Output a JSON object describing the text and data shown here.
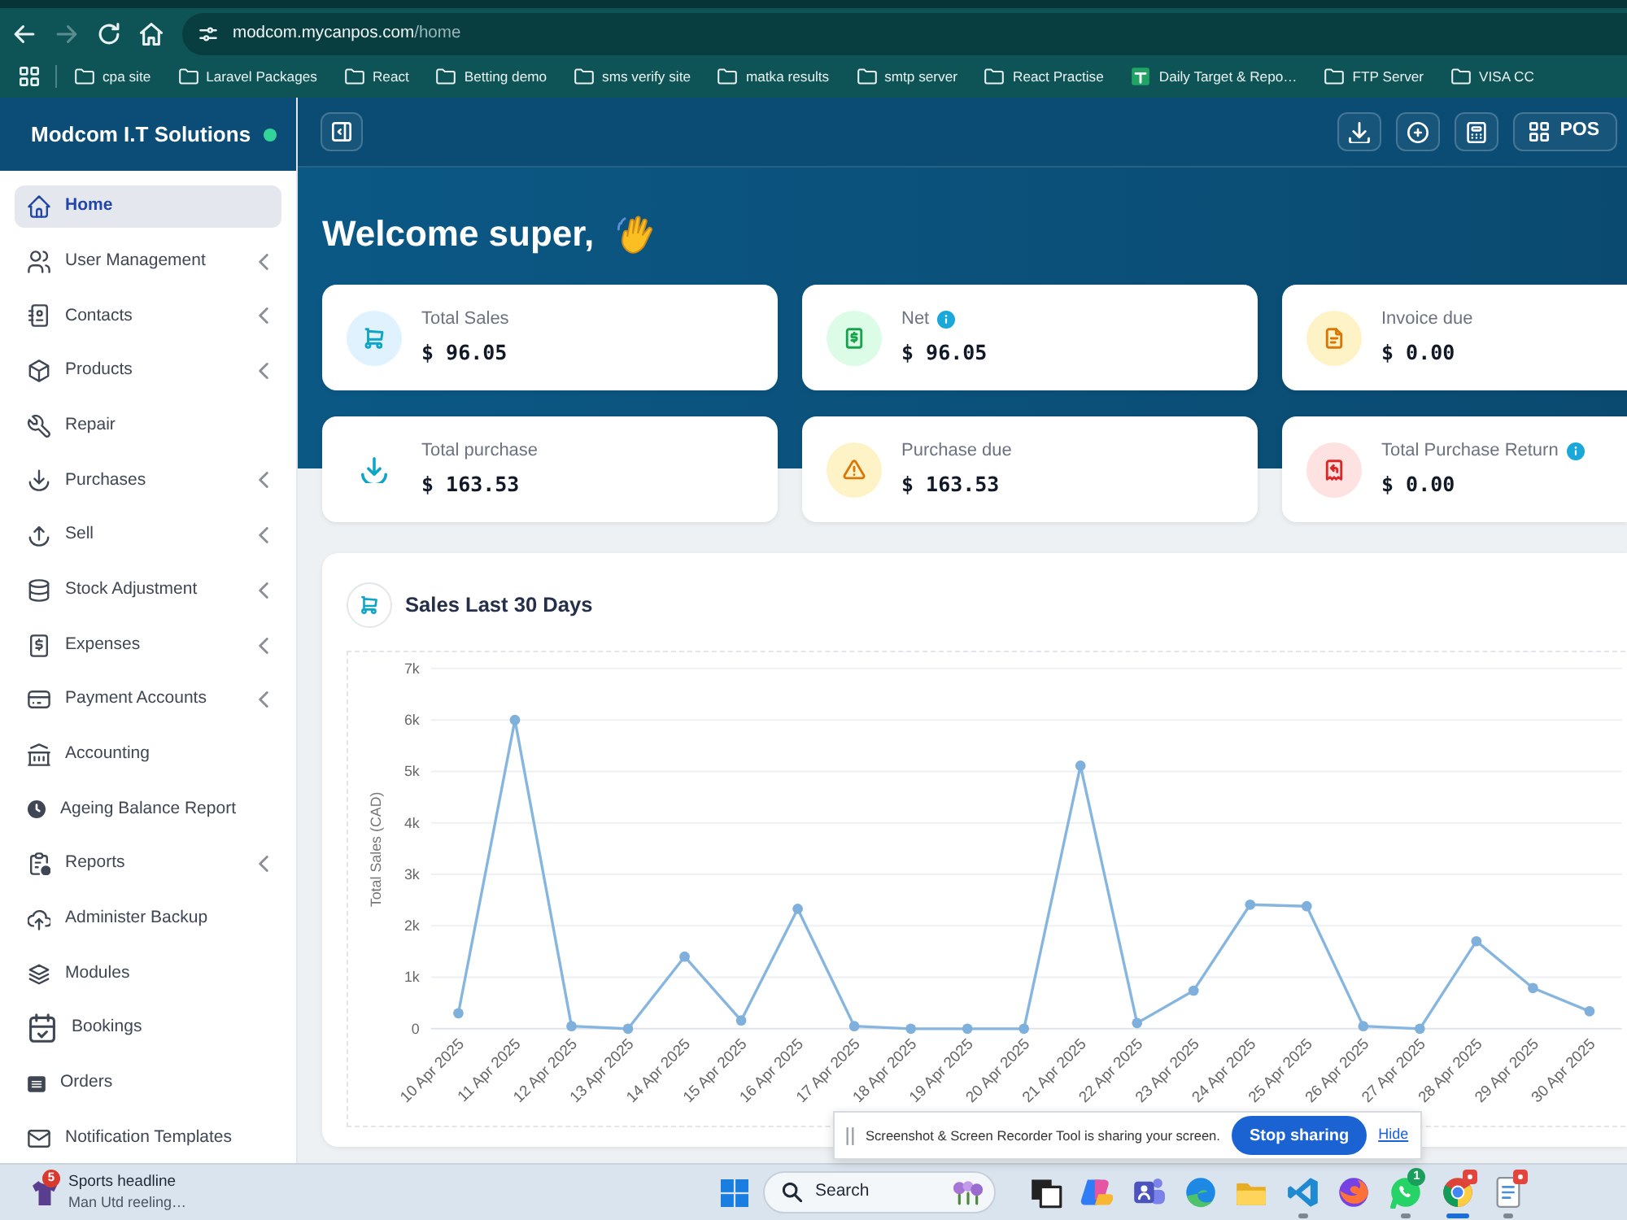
{
  "browser": {
    "back": {
      "disabled": false
    },
    "forward": {
      "disabled": true
    },
    "url": {
      "host": "modcom.mycanpos.com",
      "path": "/home"
    },
    "bookmarks": [
      {
        "kind": "folder",
        "label": "cpa site"
      },
      {
        "kind": "folder",
        "label": "Laravel Packages"
      },
      {
        "kind": "folder",
        "label": "React"
      },
      {
        "kind": "folder",
        "label": "Betting demo"
      },
      {
        "kind": "folder",
        "label": "sms verify site"
      },
      {
        "kind": "folder",
        "label": "matka results"
      },
      {
        "kind": "folder",
        "label": "smtp server"
      },
      {
        "kind": "folder",
        "label": "React Practise"
      },
      {
        "kind": "sheet",
        "label": "Daily Target & Repo…"
      },
      {
        "kind": "folder",
        "label": "FTP Server"
      },
      {
        "kind": "folder",
        "label": "VISA CC"
      }
    ]
  },
  "sidebar": {
    "brand": {
      "name": "Modcom I.T Solutions",
      "online": true
    },
    "items": [
      {
        "label": "Home",
        "selected": true,
        "submenu": false
      },
      {
        "label": "User Management",
        "selected": false,
        "submenu": true
      },
      {
        "label": "Contacts",
        "selected": false,
        "submenu": true
      },
      {
        "label": "Products",
        "selected": false,
        "submenu": true
      },
      {
        "label": "Repair",
        "selected": false,
        "submenu": false
      },
      {
        "label": "Purchases",
        "selected": false,
        "submenu": true
      },
      {
        "label": "Sell",
        "selected": false,
        "submenu": true
      },
      {
        "label": "Stock Adjustment",
        "selected": false,
        "submenu": true
      },
      {
        "label": "Expenses",
        "selected": false,
        "submenu": true
      },
      {
        "label": "Payment Accounts",
        "selected": false,
        "submenu": true
      },
      {
        "label": "Accounting",
        "selected": false,
        "submenu": false
      },
      {
        "label": "Ageing Balance Report",
        "selected": false,
        "submenu": false
      },
      {
        "label": "Reports",
        "selected": false,
        "submenu": true
      },
      {
        "label": "Administer Backup",
        "selected": false,
        "submenu": false
      },
      {
        "label": "Modules",
        "selected": false,
        "submenu": false
      },
      {
        "label": "Bookings",
        "selected": false,
        "submenu": false
      },
      {
        "label": "Orders",
        "selected": false,
        "submenu": false
      },
      {
        "label": "Notification Templates",
        "selected": false,
        "submenu": false
      }
    ]
  },
  "header": {
    "pos_label": "POS"
  },
  "welcome": {
    "title": "Welcome super,"
  },
  "stats": [
    {
      "label": "Total Sales",
      "value": "$ 96.05",
      "info": false
    },
    {
      "label": "Net",
      "value": "$ 96.05",
      "info": true
    },
    {
      "label": "Invoice due",
      "value": "$ 0.00",
      "info": false
    },
    {
      "label": "Total purchase",
      "value": "$ 163.53",
      "info": false
    },
    {
      "label": "Purchase due",
      "value": "$ 163.53",
      "info": false
    },
    {
      "label": "Total Purchase Return",
      "value": "$ 0.00",
      "info": true
    }
  ],
  "sales_chart": {
    "chart_data": {
      "type": "line",
      "title": "Sales Last 30 Days",
      "ylabel": "Total Sales (CAD)",
      "grid": true,
      "marker": true,
      "categories": [
        "10 Apr 2025",
        "11 Apr 2025",
        "12 Apr 2025",
        "13 Apr 2025",
        "14 Apr 2025",
        "15 Apr 2025",
        "16 Apr 2025",
        "17 Apr 2025",
        "18 Apr 2025",
        "19 Apr 2025",
        "20 Apr 2025",
        "21 Apr 2025",
        "22 Apr 2025",
        "23 Apr 2025",
        "24 Apr 2025",
        "25 Apr 2025",
        "26 Apr 2025",
        "27 Apr 2025",
        "28 Apr 2025",
        "29 Apr 2025",
        "30 Apr 2025"
      ],
      "values": [
        300,
        6000,
        50,
        0,
        1400,
        160,
        2330,
        50,
        0,
        0,
        0,
        5110,
        110,
        740,
        2410,
        2380,
        50,
        0,
        1700,
        790,
        340
      ],
      "ylim": [
        0,
        7000
      ],
      "yticks": [
        {
          "value": 0,
          "label": "0"
        },
        {
          "value": 1000,
          "label": "1k"
        },
        {
          "value": 2000,
          "label": "2k"
        },
        {
          "value": 3000,
          "label": "3k"
        },
        {
          "value": 4000,
          "label": "4k"
        },
        {
          "value": 5000,
          "label": "5k"
        },
        {
          "value": 6000,
          "label": "6k"
        },
        {
          "value": 7000,
          "label": "7k"
        }
      ]
    }
  },
  "share_bar": {
    "message": "Screenshot & Screen Recorder Tool is sharing your screen.",
    "stop_label": "Stop sharing",
    "hide_label": "Hide"
  },
  "taskbar": {
    "widget": {
      "badge": "5",
      "title": "Sports headline",
      "subtitle": "Man Utd reeling…"
    },
    "search": {
      "label": "Search"
    },
    "apps": [
      {
        "running": false,
        "selected": false,
        "alert": false
      },
      {
        "running": false,
        "selected": false,
        "alert": false
      },
      {
        "running": false,
        "selected": false,
        "alert": false
      },
      {
        "running": false,
        "selected": false,
        "alert": false
      },
      {
        "running": false,
        "selected": false,
        "alert": false
      },
      {
        "running": true,
        "selected": false,
        "alert": false
      },
      {
        "running": false,
        "selected": false,
        "alert": false
      },
      {
        "running": true,
        "selected": false,
        "alert": false,
        "badge": "1"
      },
      {
        "running": true,
        "selected": true,
        "alert": true
      },
      {
        "running": true,
        "selected": false,
        "alert": true
      }
    ]
  }
}
